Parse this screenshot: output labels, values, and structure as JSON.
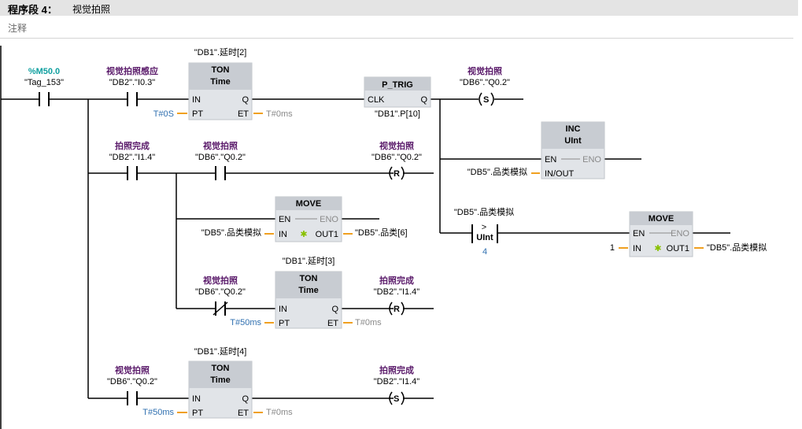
{
  "header": {
    "segment_label": "程序段 4：",
    "segment_name": "视觉拍照",
    "comment_label": "注释"
  },
  "contacts": {
    "m50": {
      "symbol": "%M50.0",
      "address": "\"Tag_153\""
    },
    "sense": {
      "symbol": "视觉拍照感应",
      "address": "\"DB2\".\"I0.3\""
    },
    "done1": {
      "symbol": "拍照完成",
      "address": "\"DB2\".\"I1.4\""
    },
    "photo1": {
      "symbol": "视觉拍照",
      "address": "\"DB6\".\"Q0.2\""
    },
    "photo_nc": {
      "symbol": "视觉拍照",
      "address": "\"DB6\".\"Q0.2\""
    },
    "photo3": {
      "symbol": "视觉拍照",
      "address": "\"DB6\".\"Q0.2\""
    }
  },
  "coils": {
    "set_photo": {
      "symbol": "视觉拍照",
      "address": "\"DB6\".\"Q0.2\"",
      "type": "S"
    },
    "reset_photo": {
      "symbol": "视觉拍照",
      "address": "\"DB6\".\"Q0.2\"",
      "type": "R"
    },
    "reset_done": {
      "symbol": "拍照完成",
      "address": "\"DB2\".\"I1.4\"",
      "type": "R"
    },
    "set_done": {
      "symbol": "拍照完成",
      "address": "\"DB2\".\"I1.4\"",
      "type": "S"
    }
  },
  "blocks": {
    "ton1": {
      "instance": "\"DB1\".延时[2]",
      "name": "TON",
      "type": "Time",
      "in": "IN",
      "pt": "PT",
      "q": "Q",
      "et": "ET",
      "pt_val": "T#0S",
      "et_val": "T#0ms"
    },
    "ptrig": {
      "name": "P_TRIG",
      "clk": "CLK",
      "q": "Q",
      "instance": "\"DB1\".P[10]"
    },
    "inc": {
      "name": "INC",
      "type": "UInt",
      "en": "EN",
      "eno": "ENO",
      "inout": "IN/OUT",
      "inout_val": "\"DB5\".品类模拟"
    },
    "move1": {
      "name": "MOVE",
      "en": "EN",
      "eno": "ENO",
      "in": "IN",
      "out": "OUT1",
      "in_val": "\"DB5\".品类模拟",
      "out_val": "\"DB5\".品类[6]"
    },
    "ton2": {
      "instance": "\"DB1\".延时[3]",
      "name": "TON",
      "type": "Time",
      "in": "IN",
      "pt": "PT",
      "q": "Q",
      "et": "ET",
      "pt_val": "T#50ms",
      "et_val": "T#0ms"
    },
    "cmp": {
      "operand1": "\"DB5\".品类模拟",
      "op": ">",
      "type": "UInt",
      "operand2": "4"
    },
    "move2": {
      "name": "MOVE",
      "en": "EN",
      "eno": "ENO",
      "in": "IN",
      "out": "OUT1",
      "in_val": "1",
      "out_val": "\"DB5\".品类模拟"
    },
    "ton3": {
      "instance": "\"DB1\".延时[4]",
      "name": "TON",
      "type": "Time",
      "in": "IN",
      "pt": "PT",
      "q": "Q",
      "et": "ET",
      "pt_val": "T#50ms",
      "et_val": "T#0ms"
    }
  },
  "colors": {
    "wire": "#000000",
    "box": "#e1e4e8",
    "box_header": "#c8ccd2",
    "pin": "#f0a020",
    "symbol": "#5a1a6a",
    "tag": "#11a0a0",
    "const": "#3070b0"
  }
}
